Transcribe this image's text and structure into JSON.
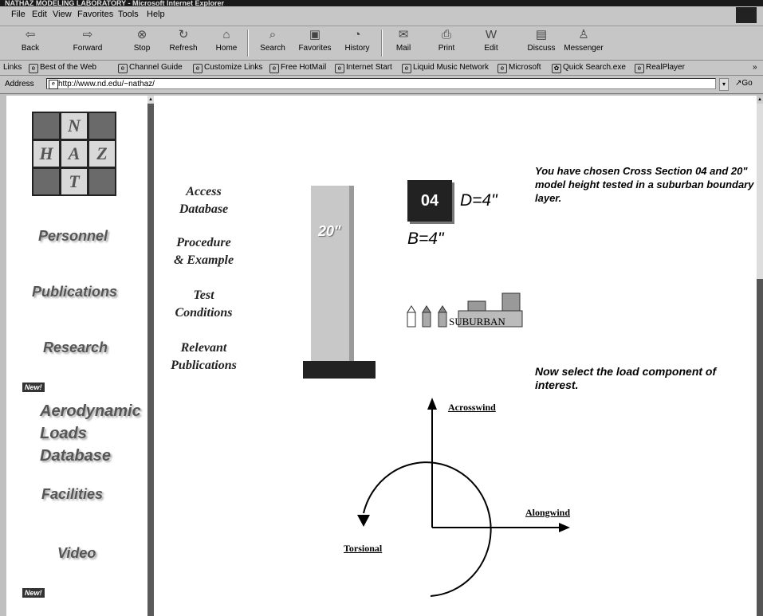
{
  "window": {
    "title": "NATHAZ MODELING LABORATORY - Microsoft Internet Explorer"
  },
  "menu": [
    "File",
    "Edit",
    "View",
    "Favorites",
    "Tools",
    "Help"
  ],
  "toolbar": [
    {
      "label": "Back",
      "icon": "back-arrow-icon"
    },
    {
      "label": "Forward",
      "icon": "forward-arrow-icon"
    },
    {
      "label": "Stop",
      "icon": "stop-icon"
    },
    {
      "label": "Refresh",
      "icon": "refresh-icon"
    },
    {
      "label": "Home",
      "icon": "home-icon"
    },
    {
      "label": "Search",
      "icon": "search-icon"
    },
    {
      "label": "Favorites",
      "icon": "favorites-icon"
    },
    {
      "label": "History",
      "icon": "history-icon"
    },
    {
      "label": "Mail",
      "icon": "mail-icon"
    },
    {
      "label": "Print",
      "icon": "print-icon"
    },
    {
      "label": "Edit",
      "icon": "edit-icon"
    },
    {
      "label": "Discuss",
      "icon": "discuss-icon"
    },
    {
      "label": "Messenger",
      "icon": "messenger-icon"
    }
  ],
  "links": {
    "label": "Links",
    "items": [
      "Best of the Web",
      "Channel Guide",
      "Customize Links",
      "Free HotMail",
      "Internet Start",
      "Liquid Music Network",
      "Microsoft",
      "Quick Search.exe",
      "RealPlayer"
    ]
  },
  "address": {
    "label": "Address",
    "url": "http://www.nd.edu/~nathaz/",
    "go": "Go"
  },
  "logo": {
    "letters": [
      "N",
      "H",
      "A",
      "Z",
      "T"
    ]
  },
  "left_nav": {
    "personnel": "Personnel",
    "publications": "Publications",
    "research": "Research",
    "new1": "New!",
    "aero1": "Aerodynamic",
    "aero2": "Loads",
    "aero3": "Database",
    "facilities": "Facilities",
    "video": "Video",
    "new2": "New!"
  },
  "main_nav": {
    "access1": "Access",
    "access2": "Database",
    "proc1": "Procedure",
    "proc2": "& Example",
    "test1": "Test",
    "test2": "Conditions",
    "rel1": "Relevant",
    "rel2": "Publications"
  },
  "model": {
    "height_label": "20\"",
    "section_badge": "04",
    "d_label": "D=4\"",
    "b_label": "B=4\"",
    "terrain": "SUBURBAN"
  },
  "info": {
    "chosen": "You have chosen Cross Section 04 and 20\" model height tested in a suburban boundary layer.",
    "select": "Now select the load component of interest."
  },
  "components": {
    "across": "Acrosswind",
    "along": "Alongwind",
    "torsional": "Torsional"
  }
}
